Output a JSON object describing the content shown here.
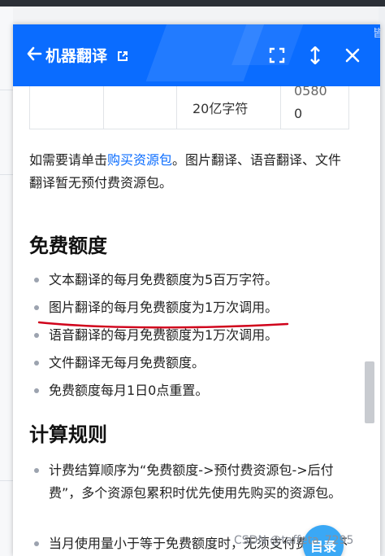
{
  "header": {
    "back_icon": "arrow-left-icon",
    "title": "机器翻译",
    "corner_text": "皆",
    "icons": [
      "external-link-icon",
      "fullscreen-icon",
      "vertical-resize-icon",
      "close-icon"
    ]
  },
  "table": {
    "cell_a": "20亿字符",
    "cell_b_line1": "0580",
    "cell_b_line2": "0"
  },
  "intro": {
    "before_link": "如需要请单击",
    "link": "购买资源包",
    "after_link": "。图片翻译、语音翻译、文件翻译暂无预付费资源包。"
  },
  "free_quota": {
    "heading": "免费额度",
    "items": [
      "文本翻译的每月免费额度为5百万字符。",
      "图片翻译的每月免费额度为1万次调用。",
      "语音翻译的每月免费额度为1万次调用。",
      "文件翻译无每月免费额度。",
      "免费额度每月1日0点重置。"
    ]
  },
  "billing_rules": {
    "heading": "计算规则",
    "items": [
      "计费结算顺序为“免费额度->预付费资源包->后付费”，多个资源包累积时优先使用先购买的资源包。",
      "当月使用量小于等于免费额度时，无须支付费用，不生成账单。"
    ]
  },
  "toc_button": "目录",
  "watermark": "CSDN @taffeta_7295",
  "colors": {
    "header_bg": "#0a6cff",
    "link": "#0a6cff",
    "toc_bg": "#3aa8f5",
    "annotation_red": "#d0021b"
  }
}
